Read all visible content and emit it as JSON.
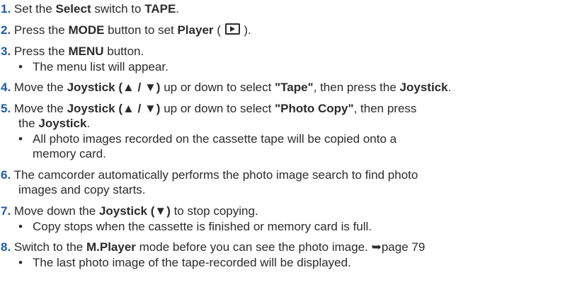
{
  "steps": [
    {
      "num": "1.",
      "t1": " Set the ",
      "b1": "Select",
      "t2": " switch to ",
      "b2": "TAPE",
      "t3": "."
    },
    {
      "num": "2.",
      "t1": " Press the ",
      "b1": "MODE",
      "t2": " button to set ",
      "b2": "Player",
      "t3": " (",
      "icon": "play-mode-icon",
      "t4": ")."
    },
    {
      "num": "3.",
      "t1": " Press the ",
      "b1": "MENU",
      "t2": " button.",
      "bullet": "The menu list will appear."
    },
    {
      "num": "4.",
      "t1": " Move the ",
      "b1": "Joystick (▲ / ▼)",
      "t2": " up or down to select ",
      "b2": "\"Tape\"",
      "t3": ", then press the ",
      "b3": "Joystick",
      "t4": "."
    },
    {
      "num": "5.",
      "t1": " Move the ",
      "b1": "Joystick (▲ / ▼)",
      "t2": " up or down to select ",
      "b2": "\"Photo Copy\"",
      "t3": ", then press",
      "c1": "the ",
      "cb1": "Joystick",
      "c2": ".",
      "bullet": "All photo images recorded on the cassette tape will be copied onto a",
      "bullet_cont": "memory card."
    },
    {
      "num": "6.",
      "t1": " The camcorder automatically performs the photo image search to find photo",
      "c1": "images and copy starts."
    },
    {
      "num": "7.",
      "t1": " Move down the ",
      "b1": "Joystick (▼)",
      "t2": " to stop copying.",
      "bullet": "Copy stops when the cassette is finished or memory card is full."
    },
    {
      "num": "8.",
      "t1": " Switch to the ",
      "b1": "M.Player",
      "t2": " mode before you can see the photo image. ",
      "arrow": "➥",
      "t3": "page 79",
      "bullet": "The last photo image of the tape-recorded will be displayed."
    }
  ],
  "bullet_glyph": "•"
}
